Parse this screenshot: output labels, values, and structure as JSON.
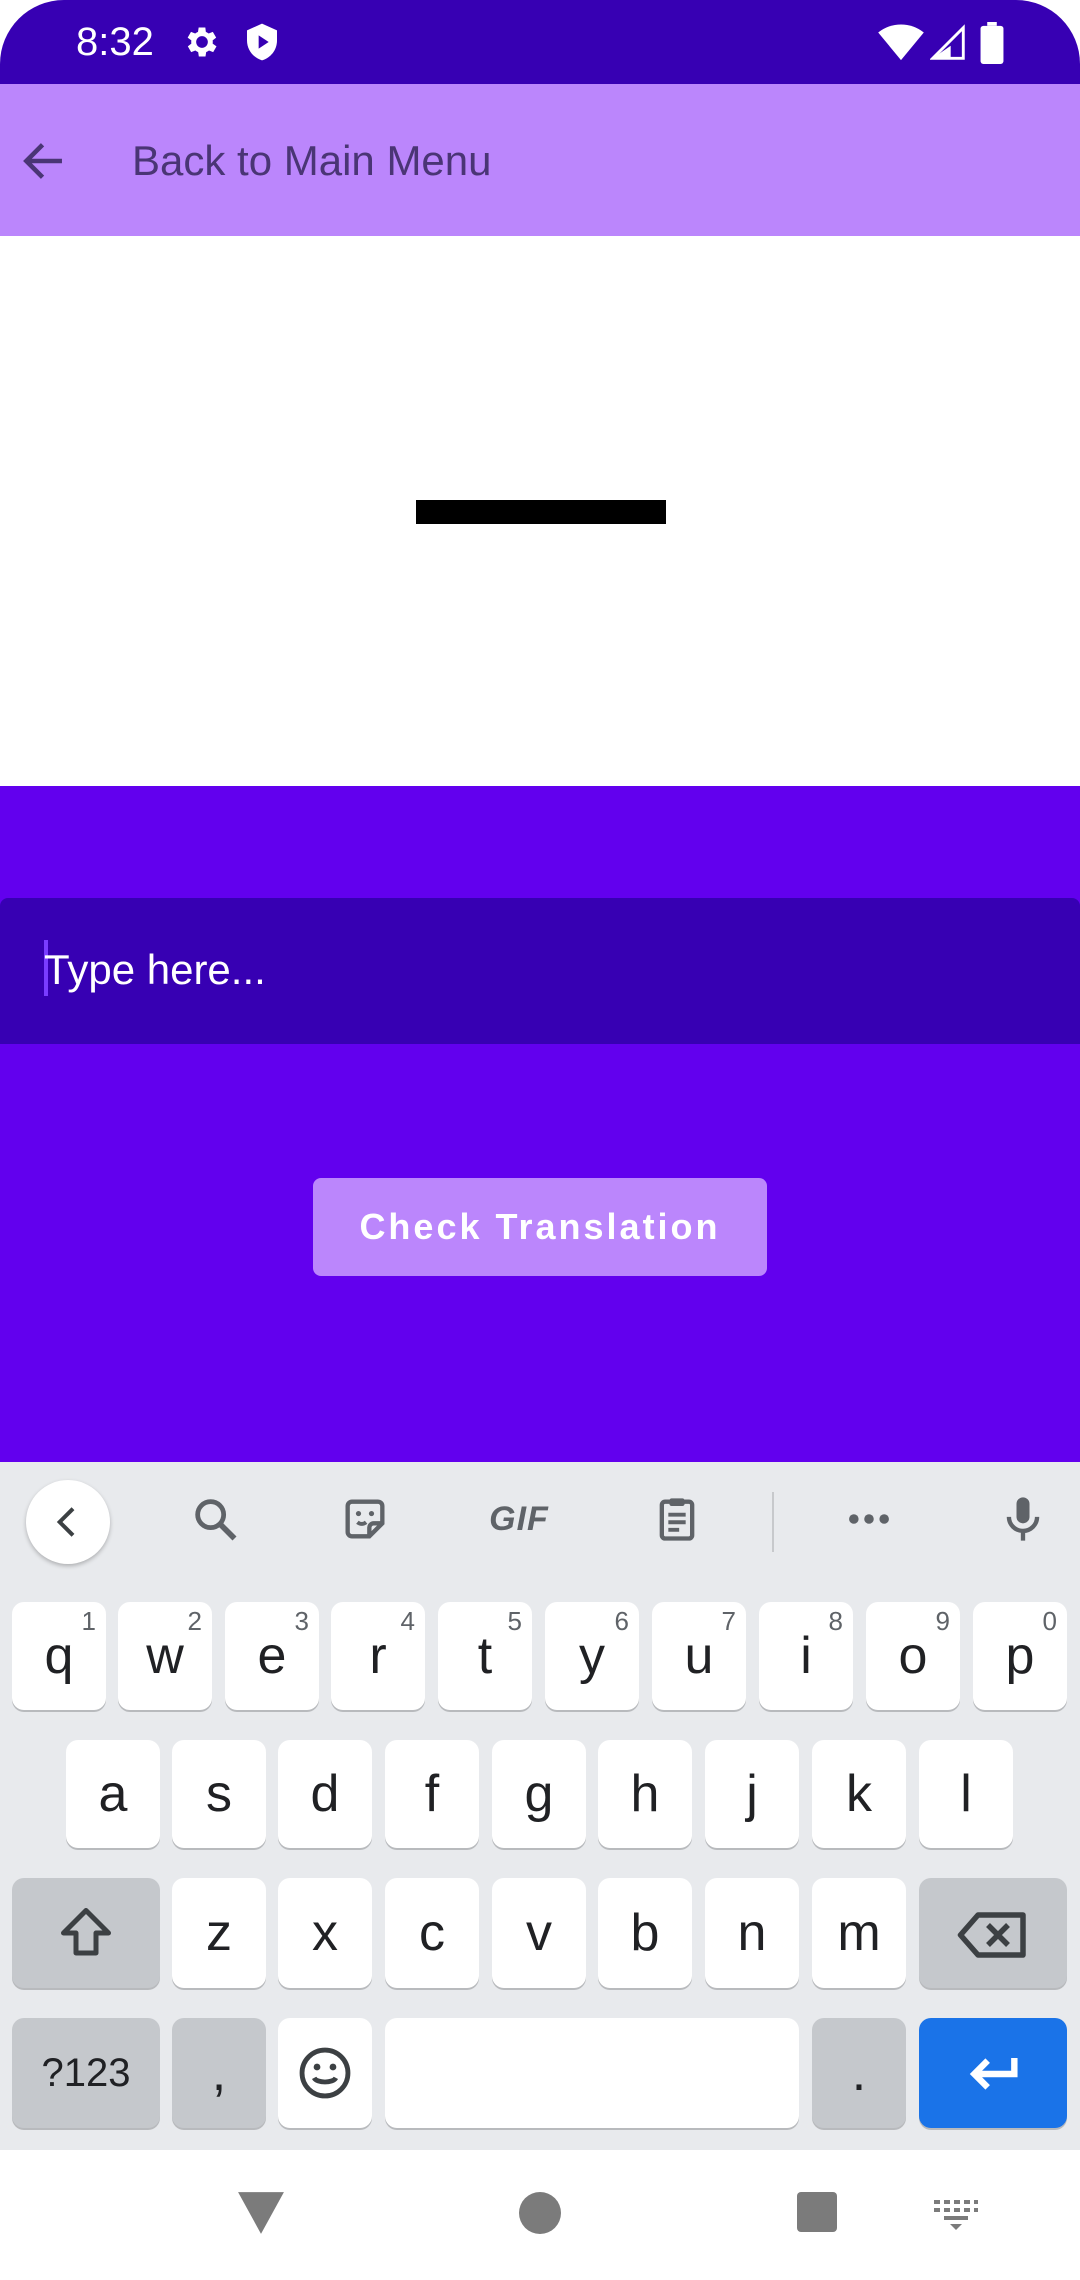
{
  "status_bar": {
    "time": "8:32",
    "icons": [
      "gear-icon",
      "shield-icon",
      "wifi-icon",
      "signal-icon",
      "battery-icon"
    ]
  },
  "app_bar": {
    "back_icon": "arrow-left-icon",
    "title": "Back to Main Menu",
    "color": "#bb86fc"
  },
  "word_area": {
    "color": "#ffffff"
  },
  "input_panel": {
    "color": "#6200ee",
    "field_color": "#3700b3",
    "placeholder": "Type here...",
    "value": ""
  },
  "check_button": {
    "label": "Check Translation"
  },
  "keyboard": {
    "toolbar": [
      "chevron-left-icon",
      "search-icon",
      "sticker-icon",
      "GIF",
      "clipboard-icon",
      "more-icon",
      "mic-icon"
    ],
    "gif_label": "GIF",
    "row1": [
      {
        "label": "q",
        "hint": "1"
      },
      {
        "label": "w",
        "hint": "2"
      },
      {
        "label": "e",
        "hint": "3"
      },
      {
        "label": "r",
        "hint": "4"
      },
      {
        "label": "t",
        "hint": "5"
      },
      {
        "label": "y",
        "hint": "6"
      },
      {
        "label": "u",
        "hint": "7"
      },
      {
        "label": "i",
        "hint": "8"
      },
      {
        "label": "o",
        "hint": "9"
      },
      {
        "label": "p",
        "hint": "0"
      }
    ],
    "row2": [
      "a",
      "s",
      "d",
      "f",
      "g",
      "h",
      "j",
      "k",
      "l"
    ],
    "row3": [
      "z",
      "x",
      "c",
      "v",
      "b",
      "n",
      "m"
    ],
    "row4": {
      "symbols": "?123",
      "comma": ",",
      "period": "."
    },
    "enter_color": "#1a73e8"
  },
  "nav_bar": {
    "icons": [
      "back-triangle-icon",
      "home-circle-icon",
      "recents-square-icon",
      "keyboard-switch-icon"
    ]
  }
}
